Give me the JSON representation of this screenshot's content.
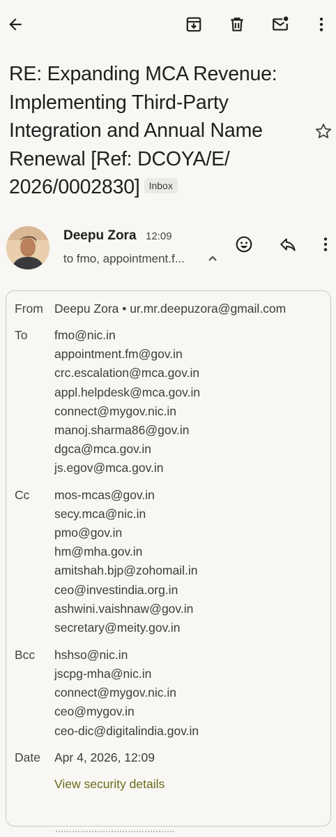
{
  "toolbar": {
    "back_icon": "arrow-back-icon",
    "archive_icon": "archive-icon",
    "delete_icon": "trash-icon",
    "unread_icon": "mark-unread-icon",
    "more_icon": "more-vert-icon"
  },
  "email": {
    "subject_lines": [
      "RE: Expanding MCA Revenue:",
      "Implementing Third-Party",
      "Integration and Annual Name",
      "Renewal [Ref: DCOYA/E/",
      "2026/0002830]"
    ],
    "label": "Inbox",
    "sender_name": "Deepu Zora",
    "time": "12:09",
    "to_summary": "to fmo, appointment.f..."
  },
  "details": {
    "from_label": "From",
    "from_value": "Deepu Zora • ur.mr.deepuzora@gmail.com",
    "to_label": "To",
    "to": [
      "fmo@nic.in",
      "appointment.fm@gov.in",
      "crc.escalation@mca.gov.in",
      "appl.helpdesk@mca.gov.in",
      "connect@mygov.nic.in",
      "manoj.sharma86@gov.in",
      "dgca@mca.gov.in",
      "js.egov@mca.gov.in"
    ],
    "cc_label": "Cc",
    "cc": [
      "mos-mcas@gov.in",
      "secy.mca@nic.in",
      "pmo@gov.in",
      "hm@mha.gov.in",
      "amitshah.bjp@zohomail.in",
      "ceo@investindia.org.in",
      "ashwini.vaishnaw@gov.in",
      "secretary@meity.gov.in"
    ],
    "bcc_label": "Bcc",
    "bcc": [
      "hshso@nic.in",
      "jscpg-mha@nic.in",
      "connect@mygov.nic.in",
      "ceo@mygov.in",
      "ceo-dic@digitalindia.gov.in"
    ],
    "date_label": "Date",
    "date_value": "Apr 4, 2026, 12:09",
    "security_link": "View security details"
  }
}
